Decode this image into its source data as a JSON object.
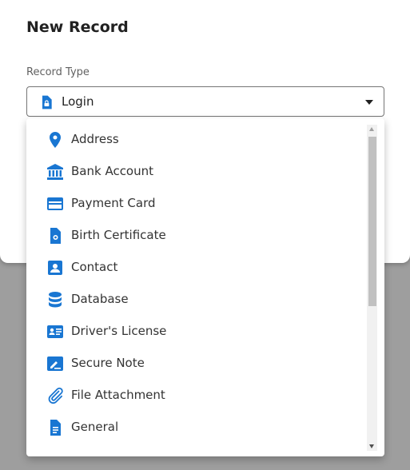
{
  "dialog": {
    "title": "New Record",
    "record_type_label": "Record Type",
    "selected": {
      "label": "Login",
      "icon": "login-lock-icon"
    }
  },
  "dropdown": {
    "options": [
      {
        "label": "Address",
        "icon": "location-pin-icon"
      },
      {
        "label": "Bank Account",
        "icon": "bank-icon"
      },
      {
        "label": "Payment Card",
        "icon": "credit-card-icon"
      },
      {
        "label": "Birth Certificate",
        "icon": "certificate-icon"
      },
      {
        "label": "Contact",
        "icon": "contact-icon"
      },
      {
        "label": "Database",
        "icon": "database-icon"
      },
      {
        "label": "Driver's License",
        "icon": "id-card-icon"
      },
      {
        "label": "Secure Note",
        "icon": "note-icon"
      },
      {
        "label": "File Attachment",
        "icon": "paperclip-icon"
      },
      {
        "label": "General",
        "icon": "document-icon"
      }
    ]
  },
  "colors": {
    "accent": "#1976d2",
    "overlay": "#9e9e9e"
  }
}
